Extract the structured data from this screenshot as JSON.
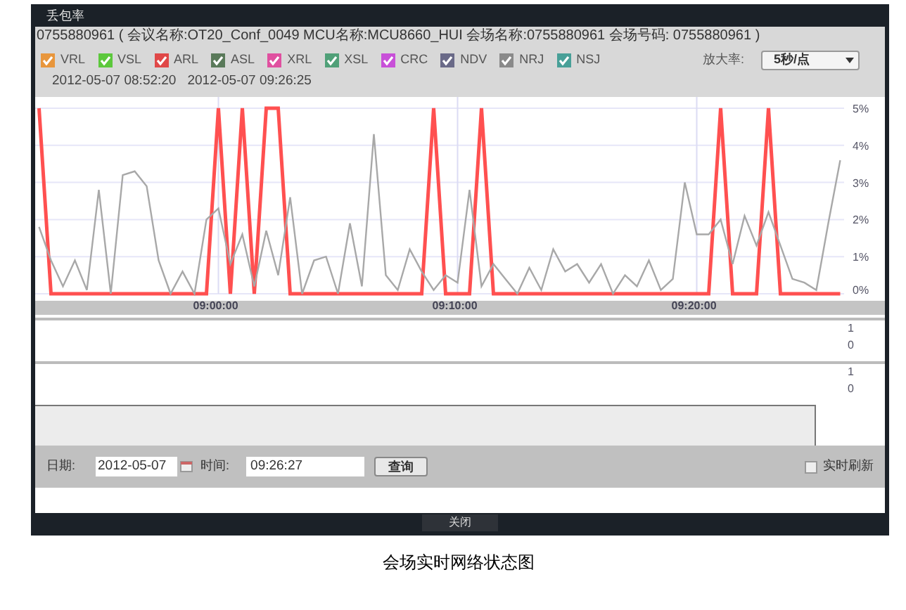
{
  "window": {
    "title": "丢包率"
  },
  "info": "0755880961 ( 会议名称:OT20_Conf_0049 MCU名称:MCU8660_HUI 会场名称:0755880961 会场号码: 0755880961 )",
  "legend": [
    {
      "label": "VRL",
      "checked": true,
      "color": "#e8963c"
    },
    {
      "label": "VSL",
      "checked": true,
      "color": "#5cc83c"
    },
    {
      "label": "ARL",
      "checked": true,
      "color": "#e04848"
    },
    {
      "label": "ASL",
      "checked": true,
      "color": "#5a7a5a"
    },
    {
      "label": "XRL",
      "checked": true,
      "color": "#e050a0"
    },
    {
      "label": "XSL",
      "checked": true,
      "color": "#50a078"
    },
    {
      "label": "CRC",
      "checked": true,
      "color": "#c850d8"
    },
    {
      "label": "NDV",
      "checked": true,
      "color": "#6a6a88"
    },
    {
      "label": "NRJ",
      "checked": true,
      "color": "#8a8a8a"
    },
    {
      "label": "NSJ",
      "checked": true,
      "color": "#48a098"
    }
  ],
  "zoom": {
    "label": "放大率:",
    "value": "5秒/点"
  },
  "range": {
    "start": "2012-05-07 08:52:20",
    "end": "2012-05-07 09:26:25"
  },
  "chart_data": {
    "type": "line",
    "ylim": [
      0,
      5
    ],
    "grid": true,
    "yticks": [
      {
        "value": 0,
        "label": "0%"
      },
      {
        "value": 1,
        "label": "1%"
      },
      {
        "value": 2,
        "label": "2%"
      },
      {
        "value": 3,
        "label": "3%"
      },
      {
        "value": 4,
        "label": "4%"
      },
      {
        "value": 5,
        "label": "5%"
      }
    ],
    "categories": [
      null,
      null,
      null,
      null,
      null,
      null,
      null,
      null,
      null,
      null,
      null,
      null,
      null,
      null,
      null,
      "09:00:00",
      null,
      null,
      null,
      null,
      null,
      null,
      null,
      null,
      null,
      null,
      null,
      null,
      null,
      null,
      null,
      null,
      null,
      null,
      null,
      "09:10:00",
      null,
      null,
      null,
      null,
      null,
      null,
      null,
      null,
      null,
      null,
      null,
      null,
      null,
      null,
      null,
      null,
      null,
      null,
      null,
      "09:20:00",
      null,
      null,
      null,
      null,
      null,
      null,
      null,
      null,
      null,
      null,
      null,
      null
    ],
    "series": [
      {
        "color": "#a8a8a8",
        "values": [
          1.8,
          0.9,
          0.2,
          0.9,
          0.1,
          2.8,
          0,
          3.2,
          3.3,
          2.9,
          0.9,
          0,
          0.6,
          0,
          2.0,
          2.3,
          0.8,
          1.6,
          0.2,
          1.7,
          0.5,
          2.6,
          0,
          0.9,
          1.0,
          0,
          1.9,
          0.2,
          4.3,
          0.5,
          0.1,
          1.2,
          0.6,
          0.1,
          0.5,
          0.3,
          2.8,
          0.2,
          0.8,
          0.4,
          0,
          0.7,
          0.1,
          1.2,
          0.6,
          0.8,
          0.3,
          0.8,
          0,
          0.5,
          0.2,
          0.9,
          0.1,
          0.4,
          3.0,
          1.6,
          1.6,
          2.0,
          0.8,
          2.1,
          1.3,
          2.2,
          1.3,
          0.4,
          0.3,
          0.1,
          1.9,
          3.6
        ]
      },
      {
        "color": "#ff5050",
        "values": [
          5,
          0,
          0,
          0,
          0,
          0,
          0,
          0,
          0,
          0,
          0,
          0,
          0,
          0,
          0,
          5,
          0,
          5,
          0,
          5,
          5,
          0,
          0,
          0,
          0,
          0,
          0,
          0,
          0,
          0,
          0,
          0,
          0,
          5,
          0,
          0,
          0,
          5,
          0,
          0,
          0,
          0,
          0,
          0,
          0,
          0,
          0,
          0,
          0,
          0,
          0,
          0,
          0,
          0,
          0,
          0,
          0,
          5,
          0,
          0,
          0,
          5,
          0,
          0,
          0,
          0,
          0,
          0
        ]
      }
    ]
  },
  "small_charts": [
    {
      "ticks": [
        "1",
        "0"
      ]
    },
    {
      "ticks": [
        "1",
        "0"
      ]
    }
  ],
  "query": {
    "date_label": "日期:",
    "date": "2012-05-07",
    "time_label": "时间:",
    "time": "09:26:27",
    "button": "查询"
  },
  "auto_refresh": {
    "label": "实时刷新",
    "checked": false
  },
  "close_button": "关闭",
  "caption": "会场实时网络状态图"
}
